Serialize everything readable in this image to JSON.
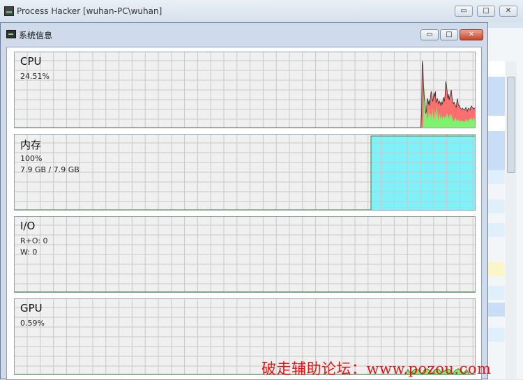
{
  "main_window": {
    "title": "Process Hacker [wuhan-PC\\wuhan]",
    "controls": {
      "minimize": "▭",
      "maximize": "□",
      "close": "✕"
    }
  },
  "dialog": {
    "title": "系统信息",
    "controls": {
      "minimize": "▭",
      "maximize": "□",
      "close": "✕"
    }
  },
  "panels": {
    "cpu": {
      "title": "CPU",
      "usage": "24.51%"
    },
    "memory": {
      "title": "内存",
      "usage": "100%",
      "detail": "7.9 GB / 7.9 GB"
    },
    "io": {
      "title": "I/O",
      "read_other": "R+O: 0",
      "write": "W: 0"
    },
    "gpu": {
      "title": "GPU",
      "usage": "0.59%"
    }
  },
  "colors": {
    "cpu_kernel": "#ff6f6f",
    "cpu_user": "#7df36d",
    "memory_fill": "#7ff2f9",
    "io_line": "#2e8b2e",
    "gpu_fill": "#7df36d",
    "grid": "#c8c8c8",
    "watermark": "#ee1111"
  },
  "graphs": {
    "cpu": {
      "total": [
        0,
        0,
        0,
        0,
        0,
        0,
        0,
        0,
        0,
        0,
        0,
        0,
        0,
        0,
        0,
        0,
        0,
        0,
        0,
        0,
        0,
        0,
        0,
        0,
        0,
        0,
        0,
        0,
        0,
        0,
        0,
        0,
        0,
        0,
        0,
        0,
        0,
        0,
        0,
        0,
        0,
        0,
        0,
        0,
        0,
        0,
        0,
        0,
        0,
        0,
        0,
        0,
        0,
        0,
        0,
        0,
        0,
        0,
        0,
        0,
        0,
        0,
        0,
        0,
        0,
        0,
        0,
        0,
        0,
        0,
        0,
        0,
        0,
        0,
        0,
        0,
        0,
        0,
        0,
        0,
        0,
        0,
        0,
        0,
        0,
        0,
        0,
        0,
        0,
        0,
        0,
        0,
        0,
        0,
        0,
        0,
        0,
        0,
        0,
        0,
        0,
        0,
        0,
        0,
        0,
        0,
        0,
        0,
        0,
        0,
        0,
        0,
        0,
        0,
        0,
        0,
        0,
        0,
        0,
        0,
        0,
        0,
        0,
        0,
        0,
        0,
        0,
        0,
        0,
        0,
        0,
        0,
        0,
        0,
        0,
        0,
        0,
        0,
        0,
        0,
        0,
        0,
        0,
        0,
        0,
        0,
        0,
        0,
        0,
        0,
        0,
        0,
        0,
        0,
        0,
        0,
        0,
        0,
        0,
        0,
        0,
        0,
        0,
        0,
        0,
        0,
        0,
        0,
        0,
        0,
        0,
        0,
        0,
        0,
        0,
        0,
        0,
        0,
        0,
        0,
        0,
        0,
        0,
        0,
        0,
        0,
        0,
        0,
        0,
        0,
        0,
        0,
        0,
        0,
        0,
        0,
        0,
        0,
        0,
        0,
        0,
        0,
        0,
        0,
        0,
        0,
        0,
        0,
        0,
        0,
        0,
        0,
        0,
        0,
        0,
        0,
        0,
        0,
        0,
        0,
        0,
        0,
        0,
        0,
        0,
        0,
        0,
        0,
        0,
        0,
        0,
        0,
        0,
        0,
        0,
        0,
        0,
        0,
        0,
        0,
        0,
        0,
        0,
        0,
        0,
        0,
        0,
        0,
        0,
        0,
        0,
        0,
        0,
        0,
        0,
        0,
        0,
        0,
        0,
        0,
        0,
        0,
        0,
        0,
        0,
        0,
        0,
        0,
        0,
        0,
        0,
        0,
        0,
        0,
        0,
        0,
        0,
        0,
        0,
        0,
        0,
        0,
        0,
        0,
        0,
        0,
        0,
        0,
        0,
        0,
        0,
        0,
        0,
        0,
        0,
        0,
        0,
        0,
        0,
        0,
        0,
        0,
        0,
        0,
        0,
        0,
        0,
        0,
        0,
        0,
        0,
        0,
        0,
        0,
        0,
        0,
        0,
        0,
        0,
        0,
        0,
        0,
        0,
        0,
        0,
        0,
        0,
        0,
        0,
        0,
        0,
        0,
        0,
        0,
        0,
        0,
        0,
        0,
        0,
        0,
        0,
        0,
        0,
        0,
        0,
        0,
        0,
        0,
        0,
        0,
        0,
        0,
        0,
        0,
        0,
        0,
        0,
        0,
        0,
        0,
        0,
        0,
        0,
        0,
        0,
        0,
        0,
        0,
        0,
        0,
        0,
        0,
        0,
        0,
        0,
        0,
        0,
        0,
        0,
        0,
        0,
        0,
        0,
        0,
        0,
        0,
        0,
        0,
        0,
        0,
        0,
        0,
        0,
        0,
        0,
        0,
        0,
        0,
        0,
        0,
        0,
        0,
        0,
        0,
        0,
        0,
        0,
        0,
        0,
        0,
        0,
        0,
        0,
        0,
        0,
        0,
        0,
        0,
        0,
        0,
        0,
        0,
        0,
        0,
        0,
        0,
        0,
        0,
        0,
        0,
        0,
        0,
        0,
        0,
        0,
        0,
        0,
        0,
        0,
        0,
        0,
        0,
        0,
        0,
        0,
        0,
        0,
        0,
        0,
        0,
        0,
        0,
        0,
        0,
        0,
        0,
        0,
        0,
        0,
        0,
        0,
        0,
        0,
        0,
        0,
        0,
        0,
        0,
        0,
        0,
        0,
        0,
        0,
        0,
        0,
        0,
        0,
        0,
        0,
        0,
        0,
        0,
        0,
        0,
        0,
        0,
        0,
        0,
        0,
        0,
        0,
        0,
        0,
        0,
        0,
        0,
        0,
        0,
        0,
        0,
        0,
        0,
        0,
        0,
        0,
        0,
        0,
        0,
        0,
        0,
        0,
        0,
        0,
        0,
        0,
        0,
        0,
        0,
        0,
        0,
        0,
        0,
        0,
        0,
        0,
        0,
        0,
        0,
        0,
        0,
        0,
        0,
        0,
        0,
        0,
        0,
        0,
        0,
        0,
        0,
        0,
        0,
        0,
        0,
        0,
        0,
        0,
        0,
        0,
        0,
        0,
        0,
        0,
        0,
        0,
        0,
        0,
        0,
        0,
        0,
        0,
        0,
        0,
        0,
        0,
        0,
        0,
        0,
        0,
        0,
        0,
        0,
        0,
        0,
        0,
        0,
        0,
        0,
        0,
        0,
        0,
        0,
        0,
        0,
        0,
        0,
        0,
        0.2,
        0.92,
        0.84,
        0.55,
        0.4,
        0.35,
        0.2,
        0.22,
        0.38,
        0.4,
        0.32,
        0.38,
        0.3,
        0.44,
        0.5,
        0.46,
        0.36,
        0.4,
        0.48,
        0.42,
        0.5,
        0.34,
        0.38,
        0.4,
        0.36,
        0.32,
        0.37,
        0.34,
        0.3,
        0.36,
        0.32,
        0.38,
        0.42,
        0.36,
        0.45,
        0.64,
        0.58,
        0.5,
        0.4,
        0.46,
        0.38,
        0.44,
        0.48,
        0.52,
        0.42,
        0.36,
        0.33,
        0.35,
        0.33,
        0.3,
        0.28,
        0.36,
        0.4,
        0.32,
        0.3,
        0.3,
        0.27,
        0.26,
        0.25,
        0.27,
        0.26,
        0.25,
        0.24,
        0.26,
        0.28,
        0.24,
        0.22,
        0.26,
        0.27,
        0.25,
        0.24,
        0.28,
        0.3,
        0.28,
        0.27,
        0.26,
        0.27,
        0.26,
        0.25,
        0.24
      ],
      "user": [
        0,
        0,
        0,
        0,
        0,
        0,
        0,
        0,
        0,
        0,
        0,
        0,
        0,
        0,
        0,
        0,
        0,
        0,
        0,
        0,
        0,
        0,
        0,
        0,
        0,
        0,
        0,
        0,
        0,
        0,
        0,
        0,
        0,
        0,
        0,
        0,
        0,
        0,
        0,
        0,
        0,
        0,
        0,
        0,
        0,
        0,
        0,
        0,
        0,
        0,
        0,
        0,
        0,
        0,
        0,
        0,
        0,
        0,
        0,
        0,
        0,
        0,
        0,
        0,
        0,
        0,
        0,
        0,
        0,
        0,
        0,
        0,
        0,
        0,
        0,
        0,
        0,
        0,
        0,
        0,
        0,
        0,
        0,
        0,
        0,
        0,
        0,
        0,
        0,
        0,
        0,
        0,
        0,
        0,
        0,
        0,
        0,
        0,
        0,
        0,
        0,
        0,
        0,
        0,
        0,
        0,
        0,
        0,
        0,
        0,
        0,
        0,
        0,
        0,
        0,
        0,
        0,
        0,
        0,
        0,
        0,
        0,
        0,
        0,
        0,
        0,
        0,
        0,
        0,
        0,
        0,
        0,
        0,
        0,
        0,
        0,
        0,
        0,
        0,
        0,
        0,
        0,
        0,
        0,
        0,
        0,
        0,
        0,
        0,
        0,
        0,
        0,
        0,
        0,
        0,
        0,
        0,
        0,
        0,
        0,
        0,
        0,
        0,
        0,
        0,
        0,
        0,
        0,
        0,
        0,
        0,
        0,
        0,
        0,
        0,
        0,
        0,
        0,
        0,
        0,
        0,
        0,
        0,
        0,
        0,
        0,
        0,
        0,
        0,
        0,
        0,
        0,
        0,
        0,
        0,
        0,
        0,
        0,
        0,
        0,
        0,
        0,
        0,
        0,
        0,
        0,
        0,
        0,
        0,
        0,
        0,
        0,
        0,
        0,
        0,
        0,
        0,
        0,
        0,
        0,
        0,
        0,
        0,
        0,
        0,
        0,
        0,
        0,
        0,
        0,
        0,
        0,
        0,
        0,
        0,
        0,
        0,
        0,
        0,
        0,
        0,
        0,
        0,
        0,
        0,
        0,
        0,
        0,
        0,
        0,
        0,
        0,
        0,
        0,
        0,
        0,
        0,
        0,
        0,
        0,
        0,
        0,
        0,
        0,
        0,
        0,
        0,
        0,
        0,
        0,
        0,
        0,
        0,
        0,
        0,
        0,
        0,
        0,
        0,
        0,
        0,
        0,
        0,
        0,
        0,
        0,
        0,
        0,
        0,
        0,
        0,
        0,
        0,
        0,
        0,
        0,
        0,
        0,
        0,
        0,
        0,
        0,
        0,
        0,
        0,
        0,
        0,
        0,
        0,
        0,
        0,
        0,
        0,
        0,
        0,
        0,
        0,
        0,
        0,
        0,
        0,
        0,
        0,
        0,
        0,
        0,
        0,
        0,
        0,
        0,
        0,
        0,
        0,
        0,
        0,
        0,
        0,
        0,
        0,
        0,
        0,
        0,
        0,
        0,
        0,
        0,
        0,
        0,
        0,
        0,
        0,
        0,
        0,
        0,
        0,
        0,
        0,
        0,
        0,
        0,
        0,
        0,
        0,
        0,
        0,
        0,
        0,
        0,
        0,
        0,
        0,
        0,
        0,
        0,
        0,
        0,
        0,
        0,
        0,
        0,
        0,
        0,
        0,
        0,
        0,
        0,
        0,
        0,
        0,
        0,
        0,
        0,
        0,
        0,
        0,
        0,
        0,
        0,
        0,
        0,
        0,
        0,
        0,
        0,
        0,
        0,
        0,
        0,
        0,
        0,
        0,
        0,
        0,
        0,
        0,
        0,
        0,
        0,
        0,
        0,
        0,
        0,
        0,
        0,
        0,
        0,
        0,
        0,
        0,
        0,
        0,
        0,
        0,
        0,
        0,
        0,
        0,
        0,
        0,
        0,
        0,
        0,
        0,
        0,
        0,
        0,
        0,
        0,
        0,
        0,
        0,
        0,
        0,
        0,
        0,
        0,
        0,
        0,
        0,
        0,
        0,
        0,
        0,
        0,
        0,
        0,
        0,
        0,
        0,
        0,
        0,
        0,
        0,
        0,
        0,
        0,
        0,
        0,
        0,
        0,
        0,
        0,
        0,
        0,
        0,
        0,
        0,
        0,
        0,
        0,
        0,
        0,
        0,
        0,
        0,
        0,
        0,
        0,
        0,
        0,
        0,
        0,
        0,
        0,
        0,
        0,
        0,
        0,
        0,
        0,
        0,
        0,
        0,
        0,
        0,
        0,
        0,
        0,
        0,
        0,
        0,
        0,
        0,
        0,
        0,
        0,
        0,
        0,
        0,
        0,
        0,
        0,
        0,
        0,
        0,
        0,
        0,
        0,
        0,
        0,
        0,
        0,
        0,
        0,
        0,
        0,
        0,
        0,
        0,
        0,
        0,
        0,
        0,
        0,
        0,
        0,
        0,
        0,
        0,
        0,
        0,
        0,
        0,
        0,
        0,
        0,
        0,
        0,
        0,
        0,
        0,
        0,
        0,
        0,
        0,
        0,
        0,
        0,
        0,
        0,
        0,
        0,
        0,
        0,
        0,
        0,
        0,
        0,
        0,
        0,
        0,
        0,
        0,
        0,
        0,
        0,
        0,
        0,
        0,
        0,
        0,
        0,
        0,
        0,
        0,
        0,
        0,
        0,
        0,
        0,
        0,
        0,
        0.18,
        0.58,
        0.5,
        0.32,
        0.24,
        0.16,
        0.12,
        0.16,
        0.26,
        0.14,
        0.2,
        0.18,
        0.12,
        0.28,
        0.2,
        0.14,
        0.1,
        0.24,
        0.2,
        0.14,
        0.3,
        0.2,
        0.1,
        0.16,
        0.2,
        0.12,
        0.14,
        0.18,
        0.12,
        0.14,
        0.18,
        0.12,
        0.16,
        0.14,
        0.14,
        0.2,
        0.18,
        0.12,
        0.14,
        0.18,
        0.12,
        0.2,
        0.16,
        0.14,
        0.1,
        0.08,
        0.12,
        0.1,
        0.14,
        0.12,
        0.08,
        0.1,
        0.12,
        0.09,
        0.1,
        0.08,
        0.1,
        0.09,
        0.1,
        0.08,
        0.09,
        0.07,
        0.09,
        0.1,
        0.12,
        0.1,
        0.08,
        0.1,
        0.12,
        0.1,
        0.12,
        0.14,
        0.12,
        0.1,
        0.12,
        0.14,
        0.12,
        0.1,
        0.12,
        0.1
      ]
    }
  },
  "watermark": {
    "text": "破走辅助论坛：www.pozou.com"
  }
}
